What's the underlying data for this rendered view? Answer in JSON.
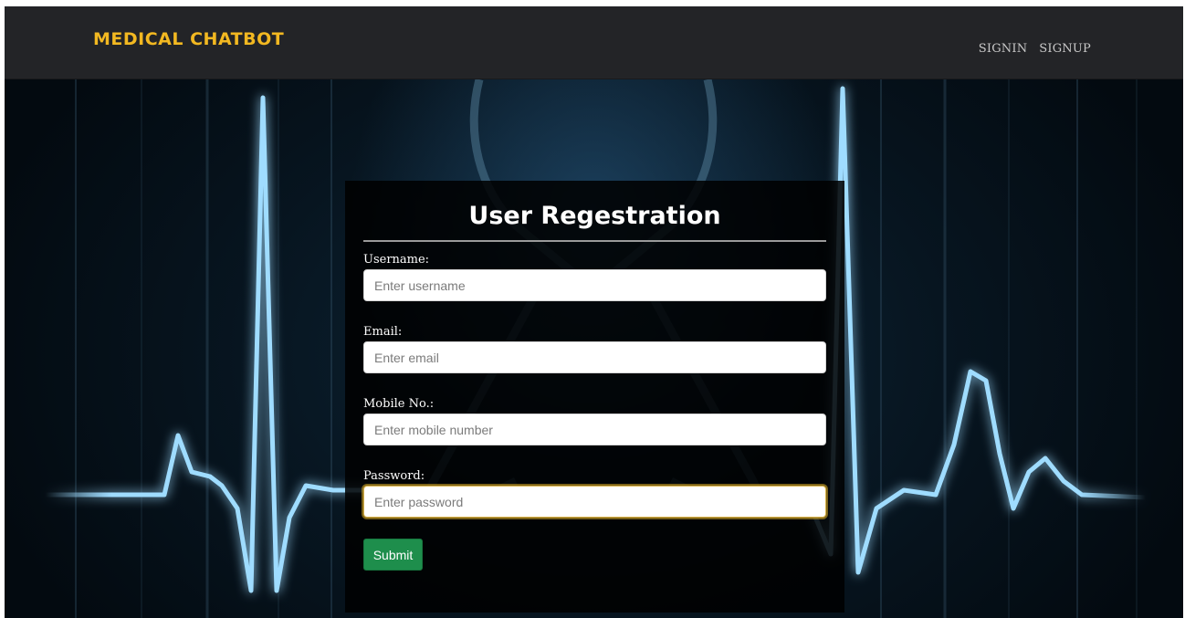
{
  "navbar": {
    "brand": "MEDICAL CHATBOT",
    "links": [
      {
        "label": "SIGNIN"
      },
      {
        "label": "SIGNUP"
      }
    ]
  },
  "form": {
    "title": "User Regestration",
    "fields": [
      {
        "label": "Username:",
        "placeholder": "Enter username",
        "value": ""
      },
      {
        "label": "Email:",
        "placeholder": "Enter email",
        "value": ""
      },
      {
        "label": "Mobile No.:",
        "placeholder": "Enter mobile number",
        "value": ""
      },
      {
        "label": "Password:",
        "placeholder": "Enter password",
        "value": "",
        "focused": true
      }
    ],
    "submit_label": "Submit"
  },
  "colors": {
    "brand": "#f2b821",
    "navbar_bg": "#232427",
    "submit_bg": "#1e8e4c",
    "focus_ring": "#e2b228"
  },
  "background": {
    "icons": [
      "ecg-heartbeat-line",
      "heart-outline",
      "awareness-ribbon"
    ]
  }
}
